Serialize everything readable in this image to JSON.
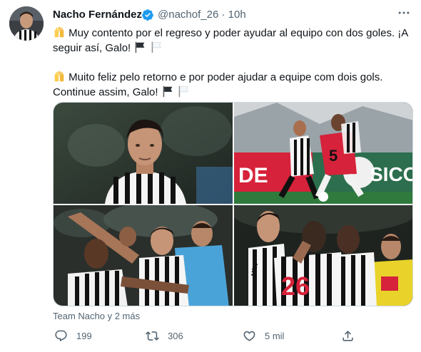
{
  "tweet": {
    "author_name": "Nacho Fernández",
    "handle": "@nachof_26",
    "separator": "·",
    "time": "10h",
    "more_icon": "more-dots-icon",
    "text_es": "Muy contento por el regreso y poder ayudar al equipo con dos goles. ¡A seguir así, Galo!",
    "text_pt": "Muito feliz pelo retorno e por poder ajudar a equipe com dois gols. Continue assim, Galo!",
    "emoji_icons": [
      "raised-hands-icon",
      "black-flag-icon",
      "white-flag-icon"
    ],
    "tagged": "Team Nacho y 2 más",
    "actions": {
      "reply_count": "199",
      "retweet_count": "306",
      "like_count": "5 mil"
    }
  },
  "colors": {
    "verified_blue": "#1d9bf0",
    "secondary_text": "#536471",
    "primary_text": "#0f1419",
    "card_border": "#cfd9de",
    "jersey_red": "#d6223a"
  },
  "media": {
    "photos": [
      "player-portrait-photo",
      "match-action-photo",
      "goal-celebration-photo",
      "team-hug-photo"
    ],
    "photo_texts": {
      "sponsor_mrv": "MRV",
      "jersey_number": "26",
      "sign_de": "DE",
      "sign_sico": "SICO",
      "jersey_5": "5"
    }
  }
}
